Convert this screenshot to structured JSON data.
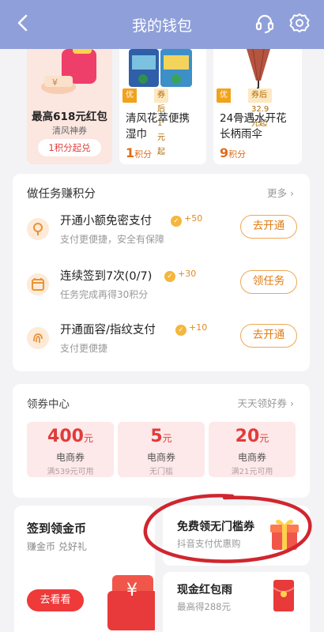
{
  "header": {
    "title": "我的钱包",
    "back_icon": "chevron-left-icon",
    "service_icon": "headset-icon",
    "settings_icon": "gear-icon",
    "bg_color": "#8f9fd9"
  },
  "products": [
    {
      "title": "最高618元红包",
      "subtitle": "清风神券",
      "action": "1积分起兑"
    },
    {
      "coupon_tag": "优惠券",
      "coupon_rule": "券后1元起",
      "name_line1": "清风花萃便携",
      "name_line2": "湿巾",
      "points": "1",
      "points_unit": "积分"
    },
    {
      "coupon_tag": "优惠券",
      "coupon_rule": "券后32.9元起",
      "name_line1": "24骨遇水开花",
      "name_line2": "长柄雨伞",
      "points": "9",
      "points_unit": "积分"
    }
  ],
  "tasks": {
    "title": "做任务赚积分",
    "more": "更多",
    "items": [
      {
        "name": "开通小额免密支付",
        "bonus": "+50",
        "desc": "支付更便捷，安全有保障",
        "button": "去开通",
        "icon": "lock-icon"
      },
      {
        "name": "连续签到7次(0/7)",
        "bonus": "+30",
        "desc": "任务完成再得30积分",
        "button": "领任务",
        "icon": "calendar-icon"
      },
      {
        "name": "开通面容/指纹支付",
        "bonus": "+10",
        "desc": "支付更便捷",
        "button": "去开通",
        "icon": "fingerprint-icon"
      }
    ]
  },
  "coupon_center": {
    "title": "领券中心",
    "more": "天天领好券",
    "coupons": [
      {
        "amount": "400",
        "unit": "元",
        "type": "电商券",
        "condition": "满539元可用"
      },
      {
        "amount": "5",
        "unit": "元",
        "type": "电商券",
        "condition": "无门槛"
      },
      {
        "amount": "20",
        "unit": "元",
        "type": "电商券",
        "condition": "满21元可用"
      }
    ]
  },
  "promos": {
    "signin": {
      "title": "签到领金币",
      "subtitle": "赚金币 兑好礼",
      "button": "去看看"
    },
    "free_coupon": {
      "title": "免费领无门槛券",
      "subtitle": "抖音支付优惠购"
    },
    "red_packet": {
      "title": "现金红包雨",
      "subtitle": "最高得288元"
    }
  }
}
